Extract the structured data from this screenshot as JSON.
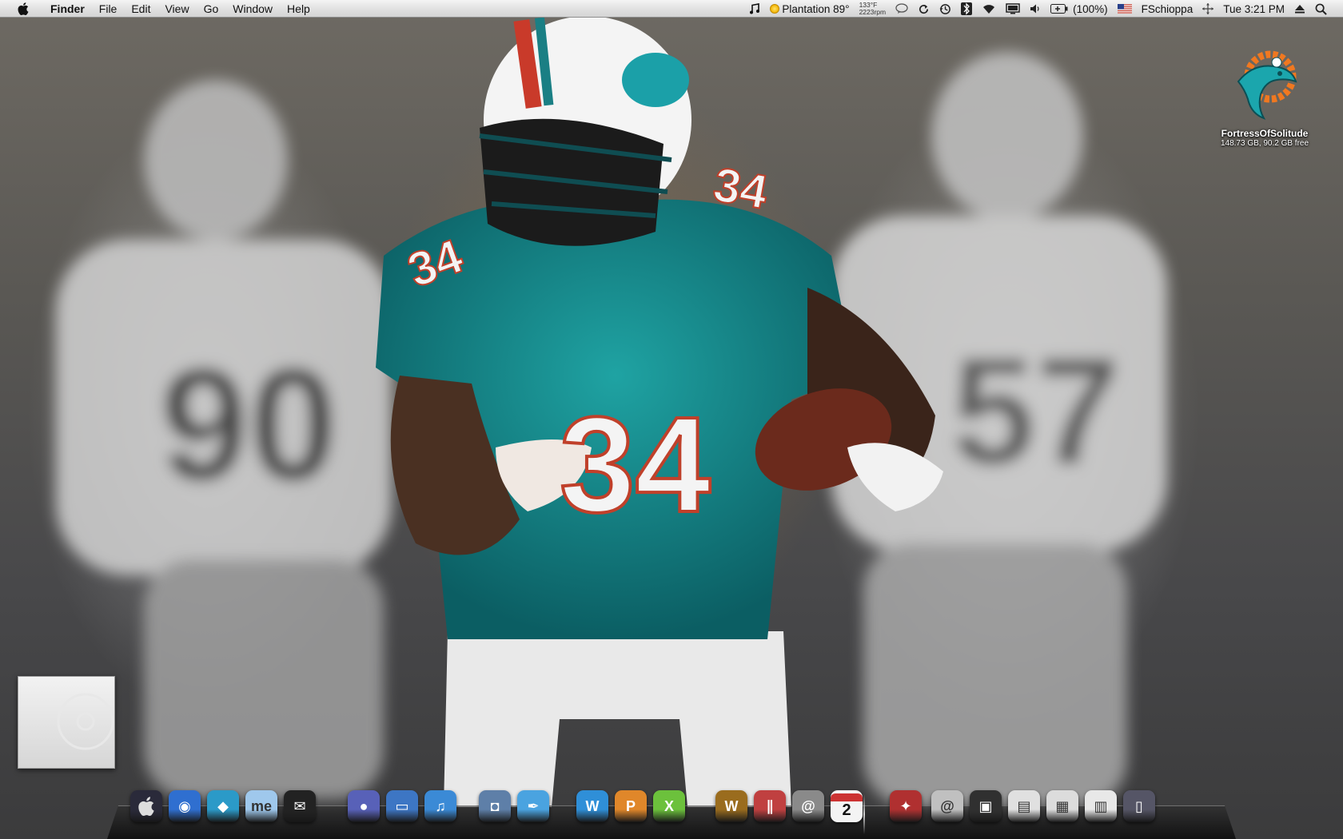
{
  "menubar": {
    "app_name": "Finder",
    "menus": [
      "File",
      "Edit",
      "View",
      "Go",
      "Window",
      "Help"
    ],
    "status": {
      "weather": "Plantation 89°",
      "cpu_temp": "133°F",
      "fan_speed": "2223rpm",
      "battery": "(100%)",
      "user": "FSchioppa",
      "clock": "Tue 3:21 PM"
    }
  },
  "desktop": {
    "drive_name": "FortressOfSolitude",
    "drive_info": "148.73 GB, 90.2 GB free"
  },
  "dock": {
    "items": [
      {
        "name": "finder-app",
        "icon": "apple-screen-icon",
        "color": "#2a2a3a"
      },
      {
        "name": "dashboard-app",
        "icon": "globe-icon",
        "color": "#2f6fd0"
      },
      {
        "name": "time-machine-app",
        "icon": "diamond-icon",
        "color": "#2b9ac8"
      },
      {
        "name": "mobileme-app",
        "icon": "cloud-me-icon",
        "color": "#9fc8ec"
      },
      {
        "name": "mail-app",
        "icon": "envelope-icon",
        "color": "#222222"
      },
      {
        "name": "ichat-app",
        "icon": "chat-orb-icon",
        "color": "#5861b8"
      },
      {
        "name": "screen-sharing-app",
        "icon": "screen-icon",
        "color": "#3d76c4"
      },
      {
        "name": "itunes-app",
        "icon": "music-note-icon",
        "color": "#3b8ad6"
      },
      {
        "name": "iphoto-app",
        "icon": "camera-icon",
        "color": "#5e7fa8"
      },
      {
        "name": "feather-app",
        "icon": "feather-icon",
        "color": "#4aa3e0"
      },
      {
        "name": "word-app",
        "icon": "word-w-icon",
        "color": "#2f8fd8"
      },
      {
        "name": "powerpoint-app",
        "icon": "powerpoint-p-icon",
        "color": "#e0872a"
      },
      {
        "name": "excel-app",
        "icon": "excel-x-icon",
        "color": "#6cc13c"
      },
      {
        "name": "warcraft-app",
        "icon": "warcraft-icon",
        "color": "#9a6c1e"
      },
      {
        "name": "parallels-app",
        "icon": "parallels-icon",
        "color": "#c04040"
      },
      {
        "name": "address-book-app",
        "icon": "at-book-icon",
        "color": "#8a8a8a"
      },
      {
        "name": "ical-app",
        "icon": "calendar-icon",
        "color": "#f2f2f2"
      },
      {
        "name": "panthers-app",
        "icon": "panther-icon",
        "color": "#b03030"
      },
      {
        "name": "mail-stack",
        "icon": "at-stack-icon",
        "color": "#c0c0c0"
      },
      {
        "name": "downloads-stack",
        "icon": "monitor-stack-icon",
        "color": "#303030"
      },
      {
        "name": "documents-stack",
        "icon": "pdf-stack-icon",
        "color": "#e0e0e0"
      },
      {
        "name": "window-stack",
        "icon": "window-stack-icon",
        "color": "#dcdcdc"
      },
      {
        "name": "spreadsheet-stack",
        "icon": "table-stack-icon",
        "color": "#e8e8e8"
      },
      {
        "name": "trash",
        "icon": "trash-icon",
        "color": "#555566"
      }
    ],
    "calendar_date": "2"
  }
}
